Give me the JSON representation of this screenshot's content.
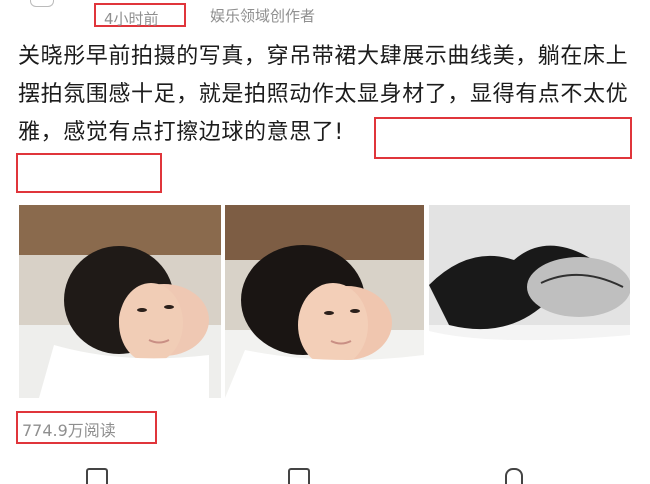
{
  "post": {
    "time": "4小时前",
    "source": "娱乐领域创作者",
    "text": "关晓彤早前拍摄的写真，穿吊带裙大肆展示曲线美，躺在床上摆拍氛围感十足，就是拍照动作太显身材了，显得有点不太优雅，感觉有点打擦边球的意思了!",
    "views": "774.9万阅读"
  },
  "photos": [
    {
      "subject": "woman lying on bed, color photo 1"
    },
    {
      "subject": "woman lying on bed, color photo 2"
    },
    {
      "subject": "woman lying on bed, black-and-white photo"
    }
  ],
  "actions": [
    {
      "icon": "share-icon"
    },
    {
      "icon": "comment-icon"
    },
    {
      "icon": "like-icon"
    }
  ],
  "colors": {
    "highlight": "#e0353b",
    "meta_text": "#8f8f8f",
    "body_text": "#1c1c1c"
  }
}
